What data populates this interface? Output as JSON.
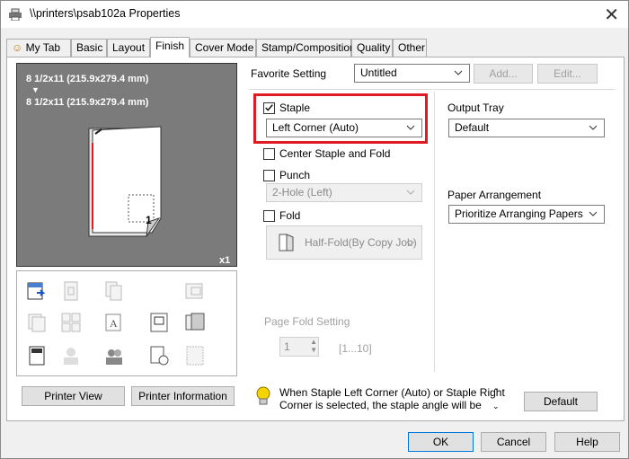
{
  "window": {
    "title": "\\\\printers\\psab102a Properties"
  },
  "tabs": [
    "My Tab",
    "Basic",
    "Layout",
    "Finish",
    "Cover Mode",
    "Stamp/Composition",
    "Quality",
    "Other"
  ],
  "preview": {
    "line1": "8 1/2x11 (215.9x279.4 mm)",
    "arrow": "▼",
    "line2": "8 1/2x11 (215.9x279.4 mm)",
    "page_num": "1",
    "copies": "x1"
  },
  "favorite": {
    "label": "Favorite Setting",
    "value": "Untitled",
    "add": "Add...",
    "edit": "Edit..."
  },
  "staple": {
    "label": "Staple",
    "checked": true,
    "value": "Left Corner (Auto)"
  },
  "center_staple": {
    "label": "Center Staple and Fold"
  },
  "punch": {
    "label": "Punch",
    "value": "2-Hole (Left)"
  },
  "fold": {
    "label": "Fold",
    "value": "Half-Fold(By Copy Job)"
  },
  "page_fold": {
    "label": "Page Fold Setting",
    "value": "1",
    "range": "[1...10]"
  },
  "output_tray": {
    "label": "Output Tray",
    "value": "Default"
  },
  "paper_arrangement": {
    "label": "Paper Arrangement",
    "value": "Prioritize Arranging Papers"
  },
  "buttons": {
    "printer_view": "Printer View",
    "printer_info": "Printer Information",
    "default": "Default",
    "ok": "OK",
    "cancel": "Cancel",
    "help": "Help"
  },
  "info": {
    "text1": "When Staple Left Corner (Auto) or Staple Right",
    "text2": "Corner is selected, the staple angle will be"
  },
  "colors": {
    "accent": "#0078d7",
    "highlight": "#e01a22"
  }
}
